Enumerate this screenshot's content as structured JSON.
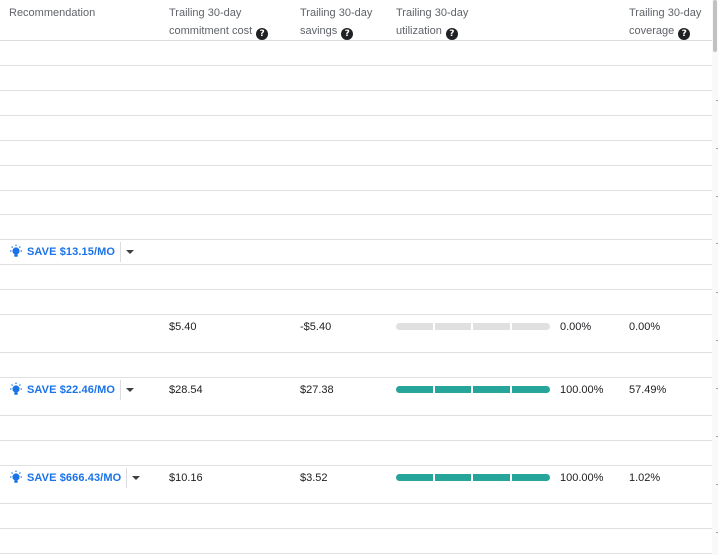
{
  "table": {
    "headers": [
      {
        "line1": "Recommendation",
        "line2": ""
      },
      {
        "line1": "Trailing 30-day",
        "line2": "commitment cost"
      },
      {
        "line1": "Trailing 30-day",
        "line2": "savings"
      },
      {
        "line1": "Trailing 30-day",
        "line2": "utilization"
      },
      {
        "line1": "Trailing 30-day",
        "line2": "coverage"
      }
    ],
    "help_glyph": "?",
    "rows": [
      {
        "recommendation": "SAVE $13.15/MO"
      },
      {
        "commitment_cost": "$5.40",
        "savings": "-$5.40",
        "utilization": "0.00%",
        "utilization_fraction": 0.0,
        "coverage": "0.00%"
      },
      {
        "recommendation": "SAVE $22.46/MO",
        "commitment_cost": "$28.54",
        "savings": "$27.38",
        "utilization": "100.00%",
        "utilization_fraction": 1.0,
        "coverage": "57.49%"
      },
      {
        "recommendation": "SAVE $666.43/MO",
        "commitment_cost": "$10.16",
        "savings": "$3.52",
        "utilization": "100.00%",
        "utilization_fraction": 1.0,
        "coverage": "1.02%"
      }
    ]
  },
  "icons": {
    "recommendation": "lightbulb-icon",
    "dropdown": "caret-down-icon",
    "help": "help-circle-icon"
  },
  "colors": {
    "link": "#1a73e8",
    "bar_fill": "#26a69a",
    "bar_track": "#e0e0e0"
  }
}
